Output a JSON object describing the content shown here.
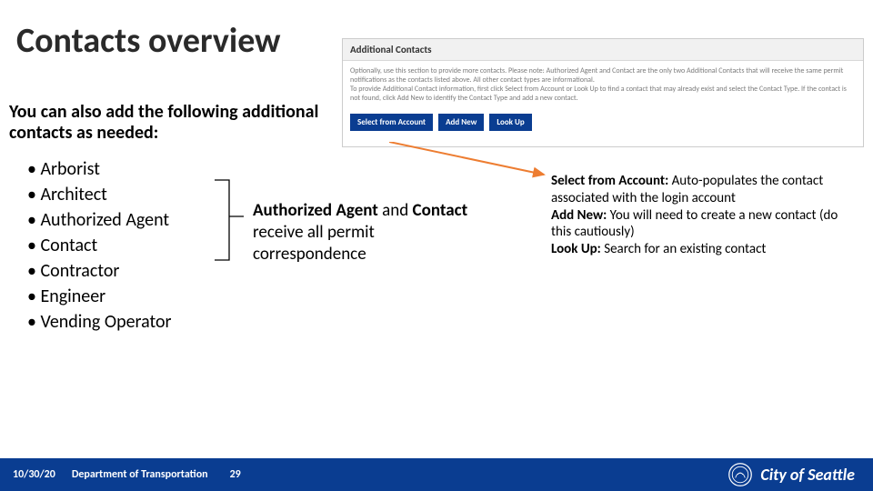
{
  "title": "Contacts overview",
  "intro": "You can also add the following additional contacts as needed:",
  "bullets": [
    "Arborist",
    "Architect",
    "Authorized Agent",
    "Contact",
    "Contractor",
    "Engineer",
    "Vending Operator"
  ],
  "callout": {
    "bold1": "Authorized Agent ",
    "mid1": "and ",
    "bold2": "Contact ",
    "rest": "receive all permit correspondence"
  },
  "screenshot": {
    "header": "Additional Contacts",
    "body_line1": "Optionally, use this section to provide more contacts. Please note: Authorized Agent and Contact are the only two Additional Contacts that will receive the same permit notifications as the contacts listed above. All other contact types are informational.",
    "body_line2": "To provide Additional Contact information, first click Select from Account or Look Up to find a contact that may already exist and select the Contact Type. If the contact is not found, click Add New to identify the Contact Type and add a new contact.",
    "buttons": [
      "Select from Account",
      "Add New",
      "Look Up"
    ]
  },
  "selectinfo": {
    "l1_bold": "Select from Account:  ",
    "l1_rest": "Auto-populates the contact associated with the login account",
    "l2_bold": "Add New: ",
    "l2_rest": "You will need to create a new contact (do this cautiously)",
    "l3_bold": "Look Up: ",
    "l3_rest": "Search for an existing contact"
  },
  "footer": {
    "date": "10/30/20",
    "dept": "Department of Transportation",
    "page": "29"
  },
  "logo_text": "City of Seattle",
  "colors": {
    "brand": "#0a3d91",
    "arrow": "#ed7d31"
  }
}
